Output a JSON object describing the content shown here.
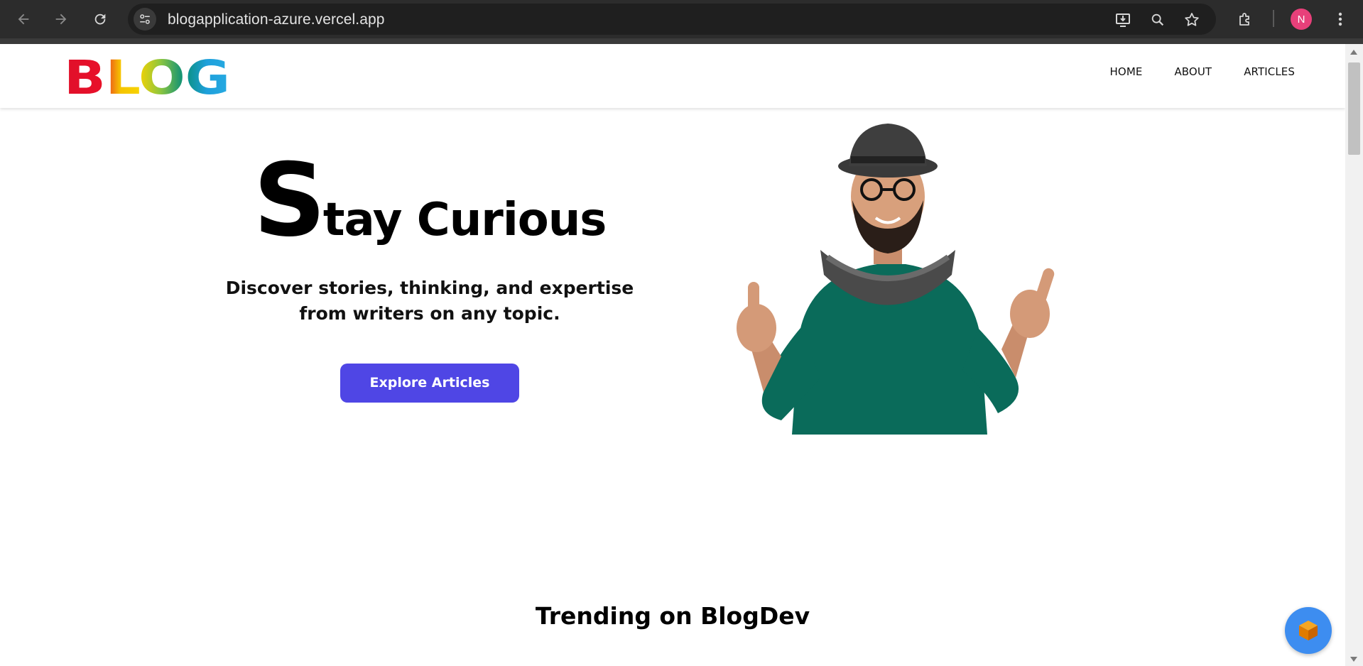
{
  "browser": {
    "url": "blogapplication-azure.vercel.app",
    "profile_initial": "N",
    "icons": [
      "back-arrow-icon",
      "forward-arrow-icon",
      "reload-icon",
      "site-info-icon",
      "install-app-icon",
      "zoom-icon",
      "bookmark-star-icon",
      "extensions-puzzle-icon",
      "more-menu-icon"
    ]
  },
  "site": {
    "logo_text": "BLOG",
    "nav": [
      {
        "label": "HOME"
      },
      {
        "label": "ABOUT"
      },
      {
        "label": "ARTICLES"
      }
    ]
  },
  "hero": {
    "title_initial": "S",
    "title_rest": "tay Curious",
    "subtitle": "Discover stories, thinking, and expertise from writers on any topic.",
    "cta_label": "Explore Articles",
    "image": "man-thumbs-up-illustration"
  },
  "trending": {
    "heading": "Trending on BlogDev"
  },
  "colors": {
    "chrome_bg": "#2c2c2c",
    "omnibox_bg": "#1f1f1f",
    "cta_bg": "#4f46e5",
    "fab_bg": "#3d8df0",
    "avatar_bg": "#e8407a"
  }
}
